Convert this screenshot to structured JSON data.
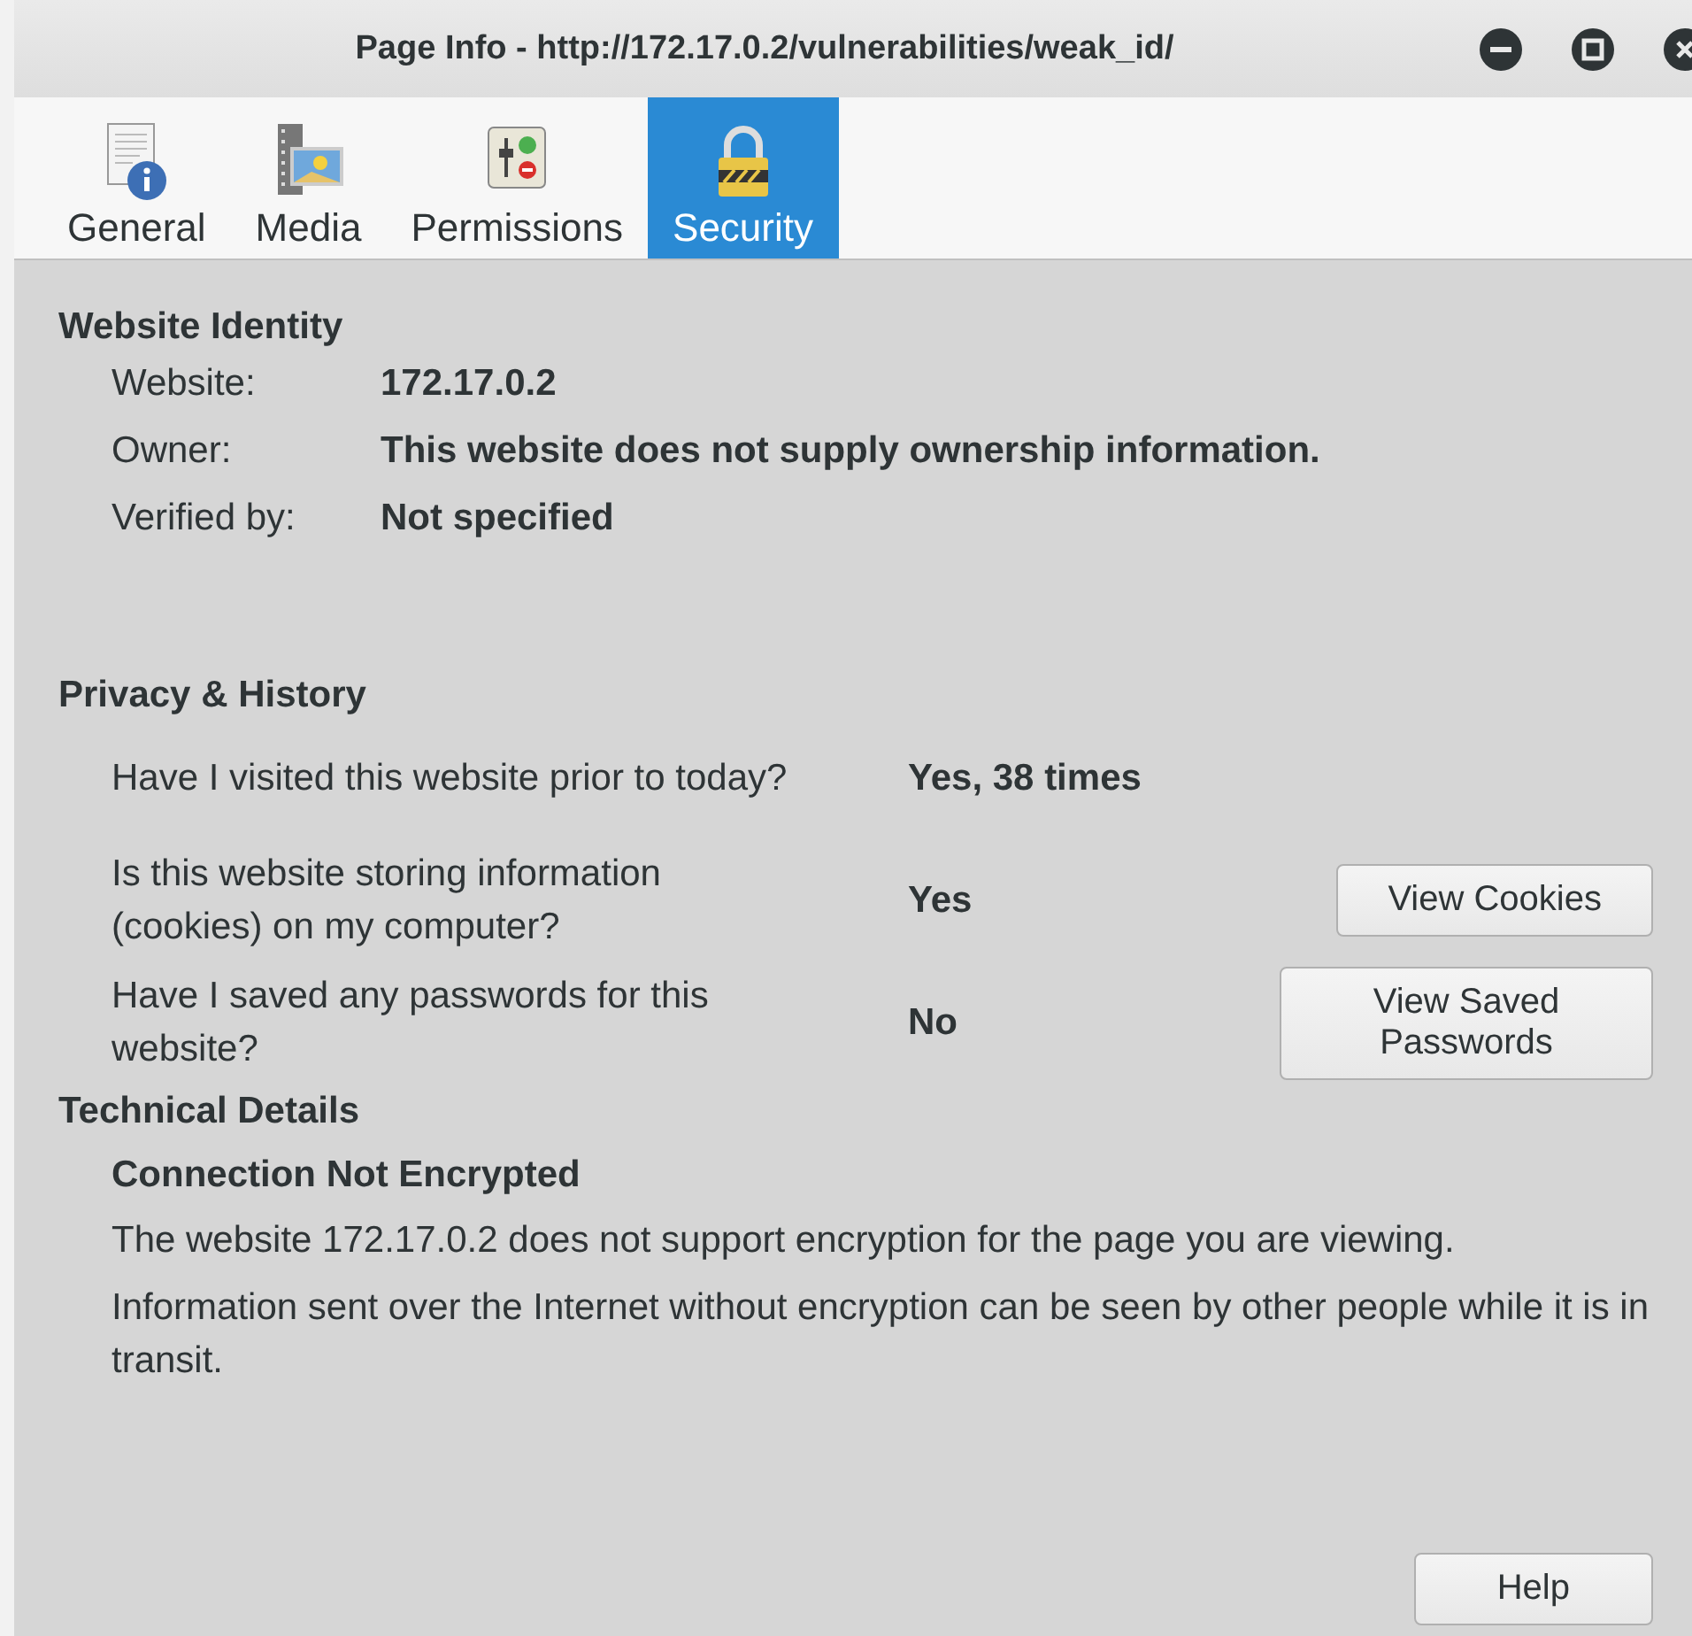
{
  "window": {
    "title": "Page Info - http://172.17.0.2/vulnerabilities/weak_id/"
  },
  "tabs": [
    {
      "label": "General",
      "kind": "general",
      "selected": false
    },
    {
      "label": "Media",
      "kind": "media",
      "selected": false
    },
    {
      "label": "Permissions",
      "kind": "permissions",
      "selected": false
    },
    {
      "label": "Security",
      "kind": "security",
      "selected": true
    }
  ],
  "identity": {
    "heading": "Website Identity",
    "rows": [
      {
        "label": "Website:",
        "value": "172.17.0.2"
      },
      {
        "label": "Owner:",
        "value": "This website does not supply ownership information."
      },
      {
        "label": "Verified by:",
        "value": "Not specified"
      }
    ]
  },
  "privacy": {
    "heading": "Privacy & History",
    "rows": [
      {
        "question": "Have I visited this website prior to today?",
        "answer": "Yes, 38 times"
      },
      {
        "question": "Is this website storing information (cookies) on my computer?",
        "answer": "Yes",
        "button": {
          "label": "View Cookies"
        }
      },
      {
        "question": "Have I saved any passwords for this website?",
        "answer": "No",
        "button": {
          "label": "View Saved Passwords"
        }
      }
    ]
  },
  "technical": {
    "heading": "Technical Details",
    "subheading": "Connection Not Encrypted",
    "paragraphs": [
      "The website 172.17.0.2 does not support encryption for the page you are viewing.",
      "Information sent over the Internet without encryption can be seen by other people while it is in transit."
    ]
  },
  "help_button": {
    "label": "Help"
  }
}
